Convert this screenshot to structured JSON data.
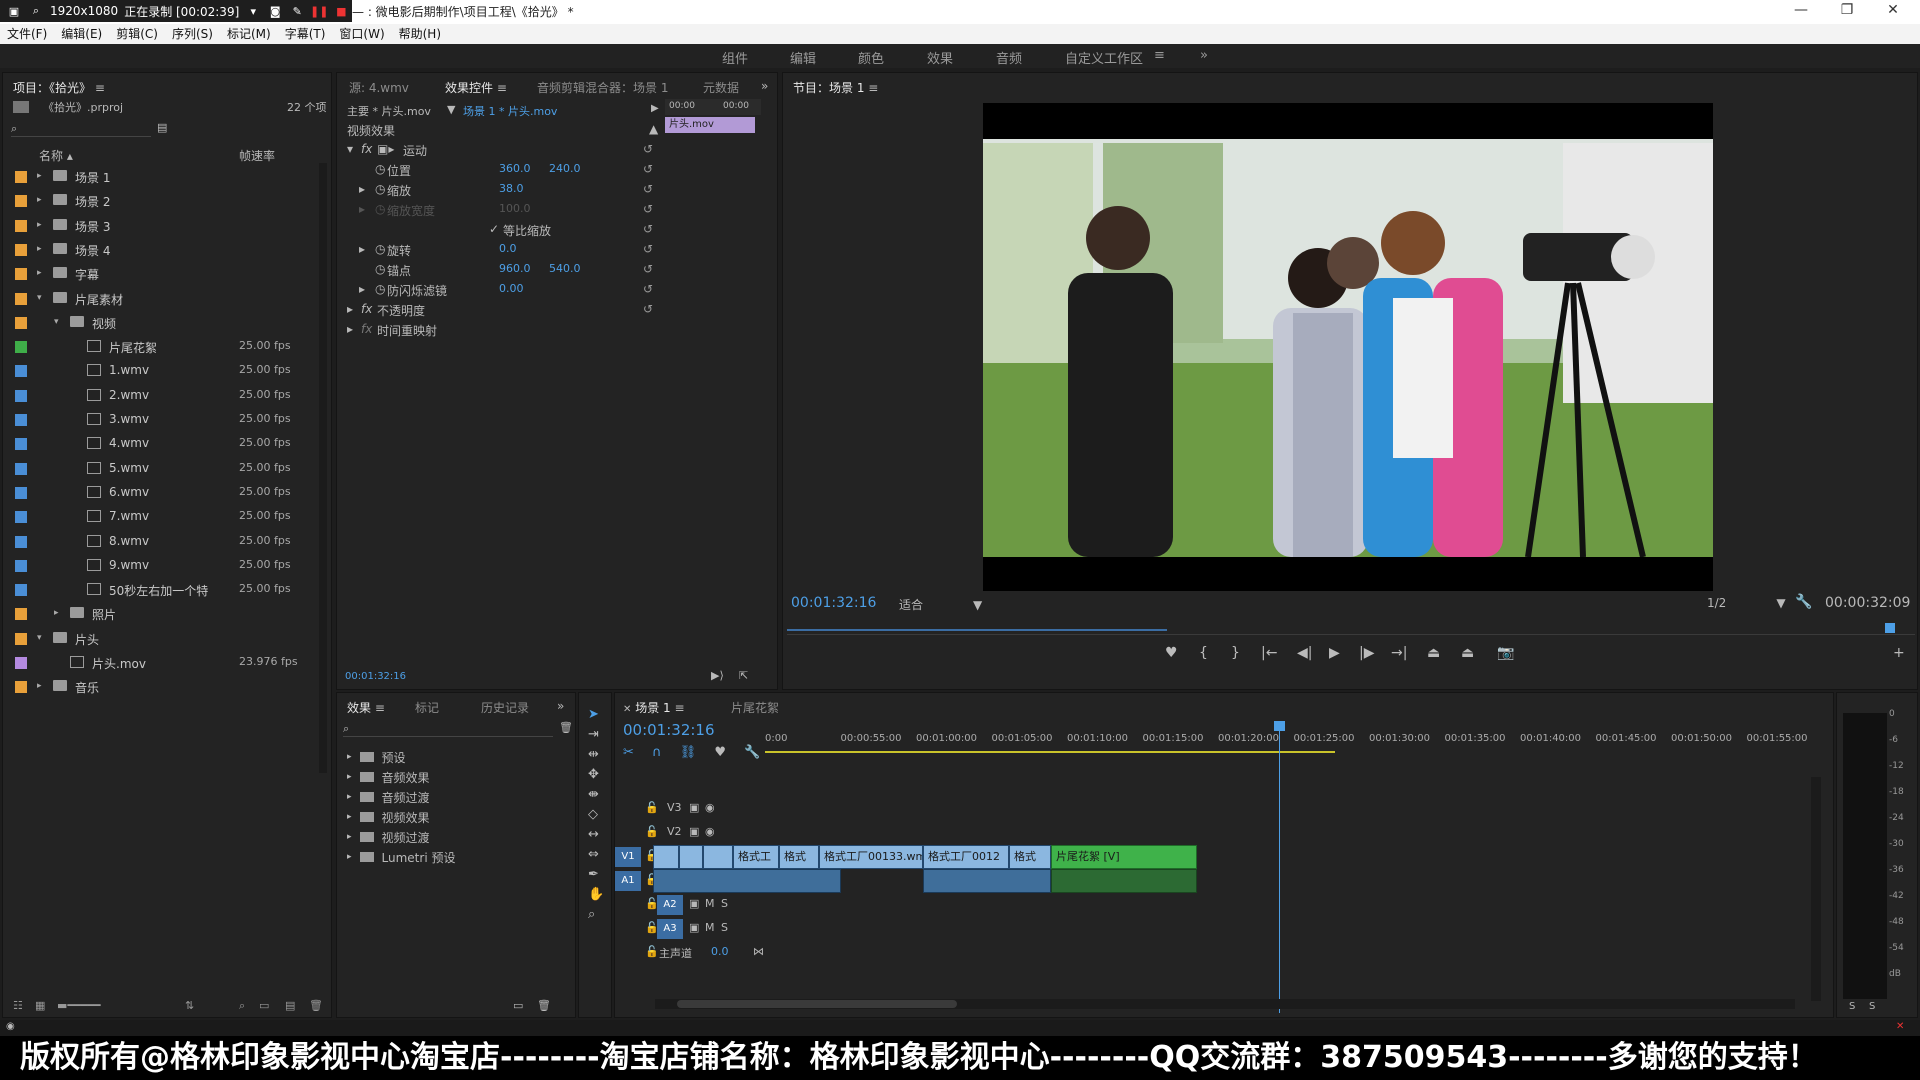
{
  "recorder": {
    "resolution": "1920x1080",
    "status": "正在录制 [00:02:39]"
  },
  "window": {
    "title": "— : 微电影后期制作\\项目工程\\《拾光》 *"
  },
  "menu": [
    "文件(F)",
    "编辑(E)",
    "剪辑(C)",
    "序列(S)",
    "标记(M)",
    "字幕(T)",
    "窗口(W)",
    "帮助(H)"
  ],
  "workspaces": [
    "组件",
    "编辑",
    "颜色",
    "效果",
    "音频",
    "自定义工作区"
  ],
  "project": {
    "tab": "项目：《拾光》",
    "file": "《拾光》.prproj",
    "count": "22 个项",
    "col_name": "名称",
    "col_fps": "帧速率",
    "items": [
      {
        "name": "场景 1",
        "fps": "",
        "kind": "folder",
        "indent": 0,
        "open": false,
        "color": "#e8a03a"
      },
      {
        "name": "场景 2",
        "fps": "",
        "kind": "folder",
        "indent": 0,
        "open": false,
        "color": "#e8a03a"
      },
      {
        "name": "场景 3",
        "fps": "",
        "kind": "folder",
        "indent": 0,
        "open": false,
        "color": "#e8a03a"
      },
      {
        "name": "场景 4",
        "fps": "",
        "kind": "folder",
        "indent": 0,
        "open": false,
        "color": "#e8a03a"
      },
      {
        "name": "字幕",
        "fps": "",
        "kind": "folder",
        "indent": 0,
        "open": false,
        "color": "#e8a03a"
      },
      {
        "name": "片尾素材",
        "fps": "",
        "kind": "folder",
        "indent": 0,
        "open": true,
        "color": "#e8a03a"
      },
      {
        "name": "视频",
        "fps": "",
        "kind": "folder",
        "indent": 1,
        "open": true,
        "color": "#e8a03a"
      },
      {
        "name": "片尾花絮",
        "fps": "25.00 fps",
        "kind": "seq",
        "indent": 2,
        "color": "#3fae49"
      },
      {
        "name": "1.wmv",
        "fps": "25.00 fps",
        "kind": "clip",
        "indent": 2,
        "color": "#4a8ed6"
      },
      {
        "name": "2.wmv",
        "fps": "25.00 fps",
        "kind": "clip",
        "indent": 2,
        "color": "#4a8ed6"
      },
      {
        "name": "3.wmv",
        "fps": "25.00 fps",
        "kind": "clip",
        "indent": 2,
        "color": "#4a8ed6"
      },
      {
        "name": "4.wmv",
        "fps": "25.00 fps",
        "kind": "clip",
        "indent": 2,
        "color": "#4a8ed6"
      },
      {
        "name": "5.wmv",
        "fps": "25.00 fps",
        "kind": "clip",
        "indent": 2,
        "color": "#4a8ed6"
      },
      {
        "name": "6.wmv",
        "fps": "25.00 fps",
        "kind": "clip",
        "indent": 2,
        "color": "#4a8ed6"
      },
      {
        "name": "7.wmv",
        "fps": "25.00 fps",
        "kind": "clip",
        "indent": 2,
        "color": "#4a8ed6"
      },
      {
        "name": "8.wmv",
        "fps": "25.00 fps",
        "kind": "clip",
        "indent": 2,
        "color": "#4a8ed6"
      },
      {
        "name": "9.wmv",
        "fps": "25.00 fps",
        "kind": "clip",
        "indent": 2,
        "color": "#4a8ed6"
      },
      {
        "name": "50秒左右加一个特",
        "fps": "25.00 fps",
        "kind": "clip",
        "indent": 2,
        "color": "#4a8ed6"
      },
      {
        "name": "照片",
        "fps": "",
        "kind": "folder",
        "indent": 1,
        "open": false,
        "color": "#e8a03a"
      },
      {
        "name": "片头",
        "fps": "",
        "kind": "folder",
        "indent": 0,
        "open": true,
        "color": "#e8a03a"
      },
      {
        "name": "片头.mov",
        "fps": "23.976 fps",
        "kind": "movie",
        "indent": 1,
        "color": "#b48ae0"
      },
      {
        "name": "音乐",
        "fps": "",
        "kind": "folder",
        "indent": 0,
        "open": false,
        "color": "#e8a03a"
      }
    ]
  },
  "fx": {
    "tabs": [
      "源: 4.wmv",
      "效果控件",
      "音频剪辑混合器：场景 1",
      "元数据"
    ],
    "master": "主要 * 片头.mov",
    "seq": "场景 1 * 片头.mov",
    "ruler_a": "00:00",
    "ruler_b": "00:00",
    "clip": "片头.mov",
    "video_fx": "视频效果",
    "motion": "运动",
    "position": "位置",
    "pos_x": "360.0",
    "pos_y": "240.0",
    "scale": "缩放",
    "scale_v": "38.0",
    "scale_w": "缩放宽度",
    "scale_w_v": "100.0",
    "uniform": "等比缩放",
    "rotation": "旋转",
    "rotation_v": "0.0",
    "anchor": "锚点",
    "anchor_x": "960.0",
    "anchor_y": "540.0",
    "flicker": "防闪烁滤镜",
    "flicker_v": "0.00",
    "opacity": "不透明度",
    "remap": "时间重映射",
    "time": "00:01:32:16"
  },
  "program": {
    "tab": "节目：场景 1",
    "time": "00:01:32:16",
    "fit": "适合",
    "res": "1/2",
    "duration": "00:00:32:09"
  },
  "effects": {
    "tabs": [
      "效果",
      "标记",
      "历史记录"
    ],
    "items": [
      "预设",
      "音频效果",
      "音频过渡",
      "视频效果",
      "视频过渡",
      "Lumetri 预设"
    ]
  },
  "timeline": {
    "tabs": [
      "场景 1",
      "片尾花絮"
    ],
    "time": "00:01:32:16",
    "ruler": [
      "0:00",
      "00:00:55:00",
      "00:01:00:00",
      "00:01:05:00",
      "00:01:10:00",
      "00:01:15:00",
      "00:01:20:00",
      "00:01:25:00",
      "00:01:30:00",
      "00:01:35:00",
      "00:01:40:00",
      "00:01:45:00",
      "00:01:50:00",
      "00:01:55:00"
    ],
    "video_tracks": [
      "V3",
      "V2",
      "V1"
    ],
    "audio_tracks": [
      "A1",
      "A2",
      "A3"
    ],
    "master": "主声道",
    "master_v": "0.0",
    "clips_v1": [
      "",
      "",
      "",
      "格式工",
      "格式",
      "格式工厂00133.wmv",
      "格式工厂0012",
      "格式",
      "片尾花絮 [V]"
    ]
  },
  "meters": {
    "labels": [
      "0",
      "-6",
      "-12",
      "-18",
      "-24",
      "-30",
      "-36",
      "-42",
      "-48",
      "-54",
      "dB"
    ],
    "solo": "S"
  },
  "banner": "版权所有@格林印象影视中心淘宝店--------淘宝店铺名称：格林印象影视中心--------QQ交流群：387509543--------多谢您的支持！"
}
